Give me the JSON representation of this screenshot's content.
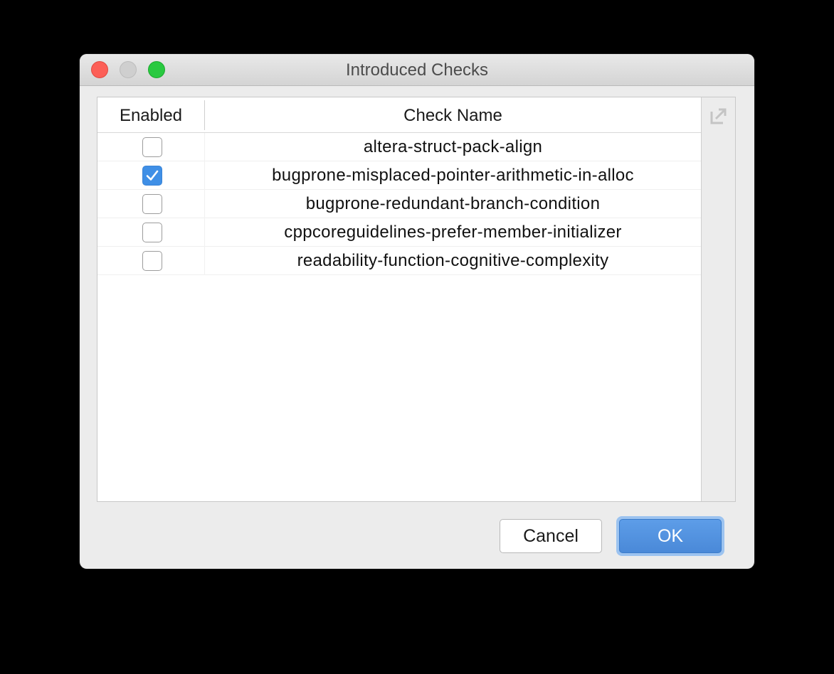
{
  "window": {
    "title": "Introduced Checks"
  },
  "table": {
    "headers": {
      "enabled": "Enabled",
      "check_name": "Check Name"
    },
    "rows": [
      {
        "enabled": false,
        "name": "altera-struct-pack-align"
      },
      {
        "enabled": true,
        "name": "bugprone-misplaced-pointer-arithmetic-in-alloc"
      },
      {
        "enabled": false,
        "name": "bugprone-redundant-branch-condition"
      },
      {
        "enabled": false,
        "name": "cppcoreguidelines-prefer-member-initializer"
      },
      {
        "enabled": false,
        "name": "readability-function-cognitive-complexity"
      }
    ]
  },
  "buttons": {
    "cancel": "Cancel",
    "ok": "OK"
  },
  "icons": {
    "export": "export-icon",
    "close": "close-icon",
    "minimize": "minimize-icon",
    "zoom": "zoom-icon"
  },
  "colors": {
    "accent": "#4a89d8",
    "checkbox_checked": "#3f8fe6",
    "close": "#fc5f57",
    "zoom": "#29c940"
  }
}
